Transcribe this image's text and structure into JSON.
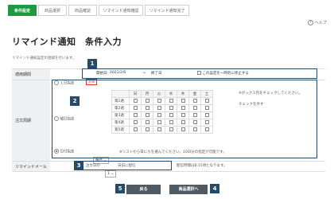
{
  "steps": [
    "条件設定",
    "商品選択",
    "商品確認",
    "リマインド通知確認",
    "リマインド通知完了"
  ],
  "help_label": "ヘルプ",
  "help_icon": "?",
  "page_title": "リマインド通知　条件入力",
  "page_subtitle": "リマインド通知設定の登録を行います。",
  "period": {
    "label": "適用期間",
    "required": "必須",
    "start_label": "開始日：",
    "start_value": "2021/2/6",
    "tilde": "〜",
    "end_label": "終了日",
    "temp_checkbox_label": "この設定を一時的に停止する"
  },
  "order_cycle": {
    "label": "注文周期",
    "option_one_day": "１日指定",
    "option_weekday": "曜日指定",
    "option_date": "日付指定",
    "weekdays": [
      "日",
      "月",
      "火",
      "水",
      "木",
      "金",
      "土"
    ],
    "weeks": [
      "第1週",
      "第2週",
      "第3週",
      "第4週",
      "第5週"
    ],
    "note1": "※ボックス内をチェックしてください。",
    "note2": "チェックを外す",
    "monthly_select": "毎月",
    "monthly_note": "※リストから日にちを選んでください。10日分の指定が可能です。"
  },
  "remind_mail": {
    "label": "リマインドメール",
    "prefix": "注文日の",
    "days_select": "1",
    "suffix": "日前に配信",
    "note": "配信時間は8:15頃となります。"
  },
  "buttons": {
    "back": "戻る",
    "next": "商品選択へ"
  },
  "badges": [
    "1",
    "2",
    "3",
    "4",
    "5"
  ],
  "colors": {
    "accent_green": "#1b9a3f",
    "badge_navy": "#254a6b",
    "required_red": "#d33333"
  }
}
